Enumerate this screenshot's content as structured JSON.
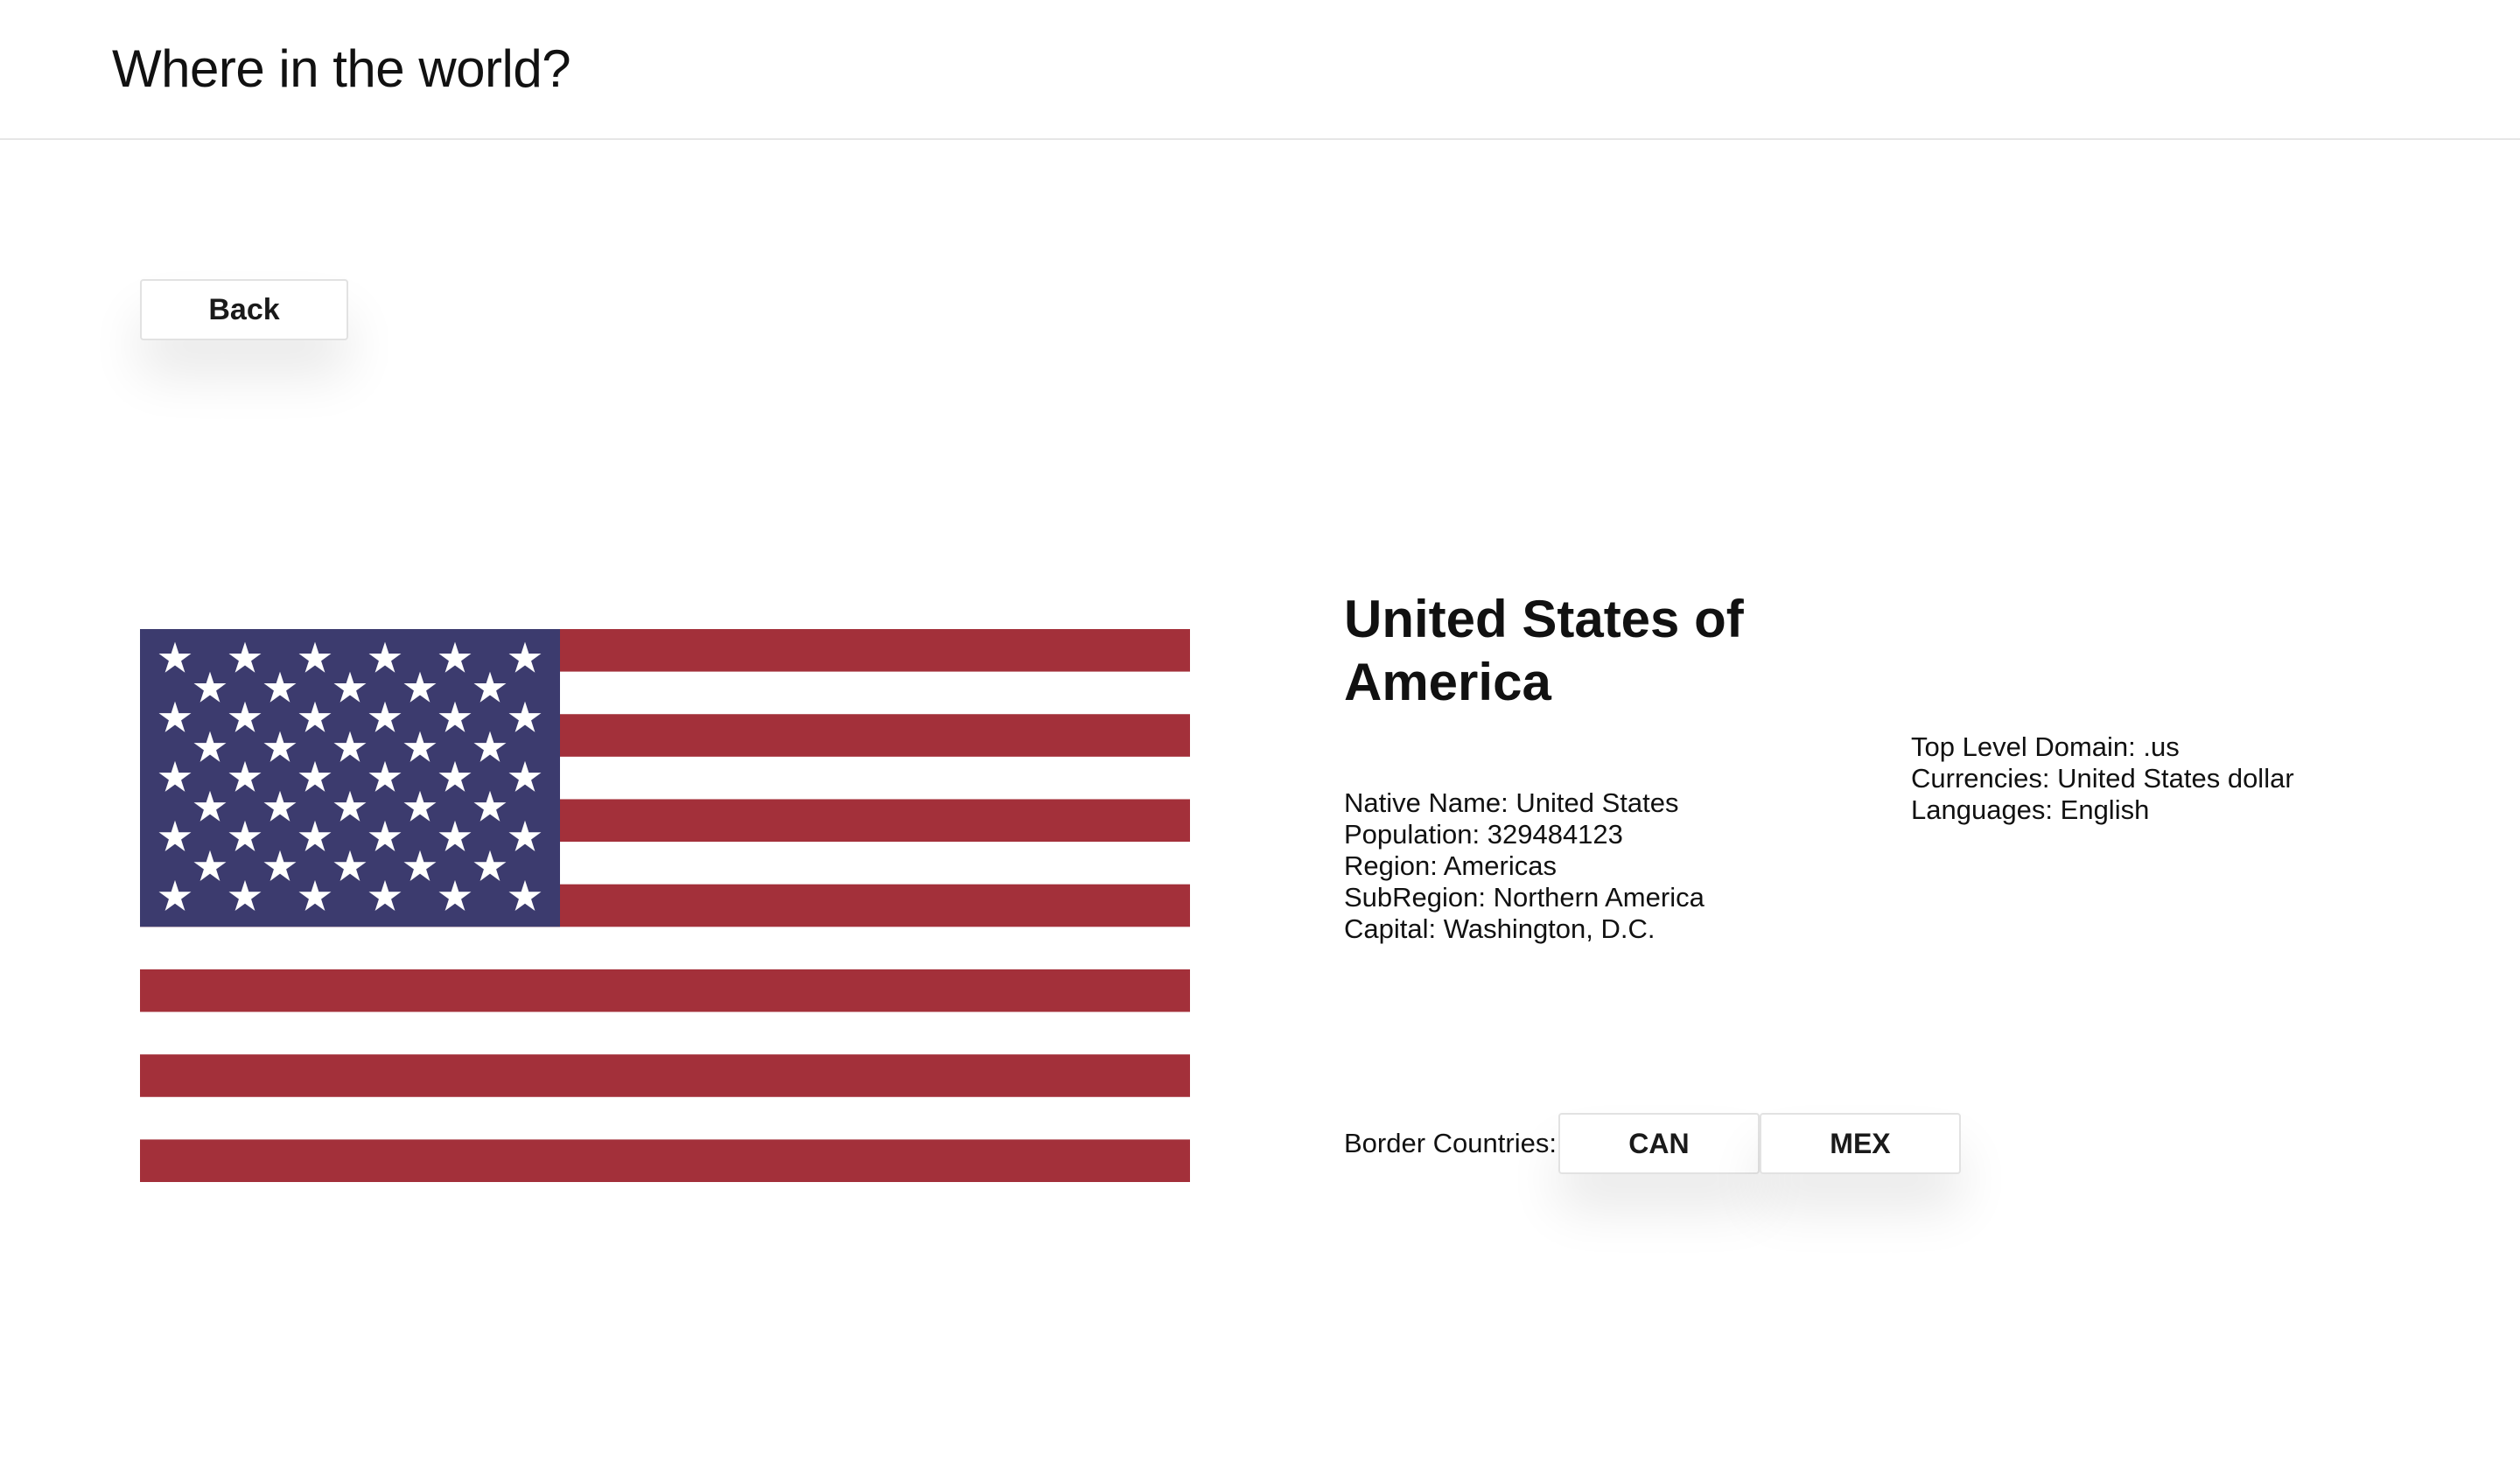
{
  "header": {
    "title": "Where in the world?"
  },
  "back_button": {
    "label": "Back"
  },
  "country": {
    "name": "United States of America",
    "flag": {
      "icon": "us-flag",
      "colors": {
        "red": "#a3303a",
        "white": "#ffffff",
        "blue": "#3c3b6e"
      }
    },
    "details_left": [
      "Native Name: United States",
      "Population: 329484123",
      "Region: Americas",
      "SubRegion: Northern America",
      "Capital: Washington, D.C."
    ],
    "details_right": [
      "Top Level Domain: .us",
      "Currencies: United States dollar",
      "Languages: English"
    ],
    "border_countries": {
      "label": "Border Countries:",
      "items": [
        "CAN",
        "MEX"
      ]
    }
  }
}
